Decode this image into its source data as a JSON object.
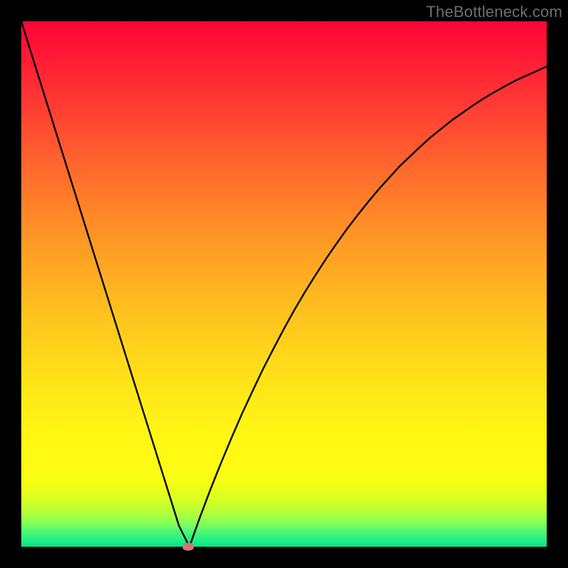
{
  "watermark": "TheBottleneck.com",
  "colors": {
    "background": "#000000",
    "gradient_top": "#ff0436",
    "gradient_bottom": "#00e68e",
    "curve": "#000000",
    "marker": "#cb7a6e"
  },
  "chart_data": {
    "type": "line",
    "title": "",
    "xlabel": "",
    "ylabel": "",
    "xlim": [
      0,
      100
    ],
    "ylim": [
      0,
      100
    ],
    "x": [
      0,
      2,
      4,
      6,
      8,
      10,
      12,
      14,
      16,
      18,
      20,
      22,
      24,
      26,
      28,
      30,
      32,
      34,
      36,
      38,
      40,
      42,
      44,
      46,
      48,
      50,
      52,
      54,
      56,
      58,
      60,
      62,
      64,
      66,
      68,
      70,
      72,
      74,
      76,
      78,
      80,
      82,
      84,
      86,
      88,
      90,
      92,
      94,
      96,
      98,
      100
    ],
    "values": [
      100.0,
      93.6,
      87.2,
      80.8,
      74.4,
      68.0,
      61.6,
      55.2,
      48.8,
      42.4,
      36.0,
      29.6,
      23.2,
      16.8,
      10.4,
      4.0,
      0.0,
      5.6,
      10.9,
      15.9,
      20.7,
      25.3,
      29.6,
      33.8,
      37.7,
      41.5,
      45.1,
      48.5,
      51.7,
      54.8,
      57.7,
      60.5,
      63.1,
      65.6,
      68.0,
      70.2,
      72.4,
      74.3,
      76.2,
      78.0,
      79.6,
      81.2,
      82.6,
      84.0,
      85.3,
      86.5,
      87.6,
      88.7,
      89.6,
      90.5,
      91.4
    ],
    "marker": {
      "x": 31.8,
      "y": 0.0
    },
    "legend": false,
    "grid": false
  }
}
